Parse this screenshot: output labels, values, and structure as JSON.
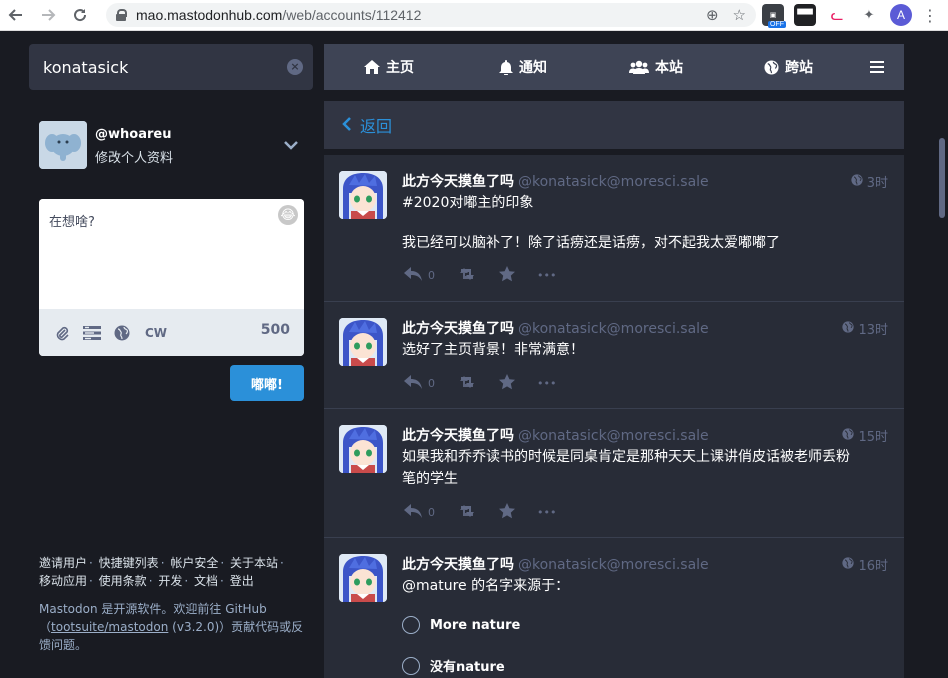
{
  "browser": {
    "url_host": "mao.mastodonhub.com",
    "url_path": "/web/accounts/112412",
    "ext_off_badge": "OFF",
    "profile_initial": "A"
  },
  "search": {
    "value": "konatasick",
    "placeholder": ""
  },
  "profile": {
    "username": "@whoareu",
    "edit_label": "修改个人资料"
  },
  "compose": {
    "placeholder": "在想啥?",
    "cw_label": "CW",
    "char_count": "500",
    "submit_label": "嘟嘟!"
  },
  "footer": {
    "links": [
      "邀请用户",
      "快捷键列表",
      "帐户安全",
      "关于本站",
      "移动应用",
      "使用条款",
      "开发",
      "文档",
      "登出"
    ],
    "about_prefix": "Mastodon 是开源软件。欢迎前往 GitHub（",
    "about_link": "tootsuite/mastodon",
    "about_suffix": " (v3.2.0)）贡献代码或反馈问题。"
  },
  "tabs": {
    "home": "主页",
    "notifications": "通知",
    "local": "本站",
    "federated": "跨站"
  },
  "back": {
    "label": "返回"
  },
  "statuses": [
    {
      "display_name": "此方今天摸鱼了吗",
      "acct": "@konatasick@moresci.sale",
      "time": "3时",
      "lines": [
        "#2020对嘟主的印象",
        "",
        "我已经可以脑补了！除了话痨还是话痨，对不起我太爱嘟嘟了"
      ],
      "replies": "0"
    },
    {
      "display_name": "此方今天摸鱼了吗",
      "acct": "@konatasick@moresci.sale",
      "time": "13时",
      "lines": [
        "选好了主页背景！非常满意！"
      ],
      "replies": "0"
    },
    {
      "display_name": "此方今天摸鱼了吗",
      "acct": "@konatasick@moresci.sale",
      "time": "15时",
      "lines": [
        "如果我和乔乔读书的时候是同桌肯定是那种天天上课讲俏皮话被老师丢粉",
        "笔的学生"
      ],
      "replies": "0"
    },
    {
      "display_name": "此方今天摸鱼了吗",
      "acct": "@konatasick@moresci.sale",
      "time": "16时",
      "lines": [
        "@mature 的名字来源于："
      ],
      "poll": [
        "More nature",
        "没有nature"
      ]
    }
  ],
  "colors": {
    "accent": "#2b90d9",
    "bg": "#191b22",
    "panel": "#282c37",
    "header": "#3e4455"
  }
}
